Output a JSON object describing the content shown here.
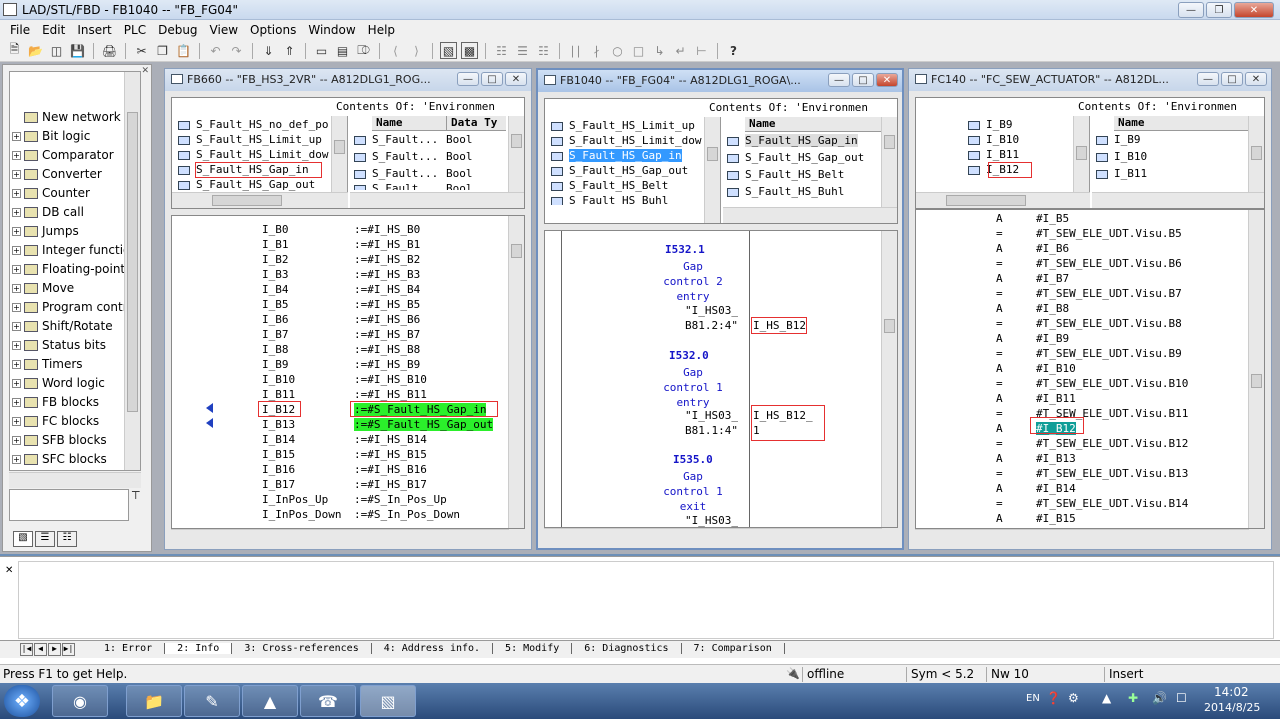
{
  "app": {
    "title": "LAD/STL/FBD  - FB1040 -- \"FB_FG04\""
  },
  "menu": [
    "File",
    "Edit",
    "Insert",
    "PLC",
    "Debug",
    "View",
    "Options",
    "Window",
    "Help"
  ],
  "catalog": {
    "items": [
      "New network",
      "Bit logic",
      "Comparator",
      "Converter",
      "Counter",
      "DB call",
      "Jumps",
      "Integer functio",
      "Floating-point",
      "Move",
      "Program contr",
      "Shift/Rotate",
      "Status bits",
      "Timers",
      "Word logic",
      "FB blocks",
      "FC blocks",
      "SFB blocks",
      "SFC blocks"
    ]
  },
  "win1": {
    "title": "FB660 -- \"FB_HS3_2VR\" -- A812DLG1_ROG...",
    "contents_label": "Contents Of: 'Environmen",
    "left_list": [
      "S_Fault_HS_no_def_po",
      "S_Fault_HS_Limit_up",
      "S_Fault_HS_Limit_dow",
      "S_Fault_HS_Gap_in",
      "S_Fault_HS_Gap_out"
    ],
    "col_name": "Name",
    "col_type": "Data Ty",
    "right_rows": [
      [
        "S_Fault...",
        "Bool"
      ],
      [
        "S_Fault...",
        "Bool"
      ],
      [
        "S_Fault...",
        "Bool"
      ],
      [
        "S_Fault...",
        "Bool"
      ]
    ],
    "code": [
      [
        "I_B0",
        ":=#I_HS_B0"
      ],
      [
        "I_B1",
        ":=#I_HS_B1"
      ],
      [
        "I_B2",
        ":=#I_HS_B2"
      ],
      [
        "I_B3",
        ":=#I_HS_B3"
      ],
      [
        "I_B4",
        ":=#I_HS_B4"
      ],
      [
        "I_B5",
        ":=#I_HS_B5"
      ],
      [
        "I_B6",
        ":=#I_HS_B6"
      ],
      [
        "I_B7",
        ":=#I_HS_B7"
      ],
      [
        "I_B8",
        ":=#I_HS_B8"
      ],
      [
        "I_B9",
        ":=#I_HS_B9"
      ],
      [
        "I_B10",
        ":=#I_HS_B10"
      ],
      [
        "I_B11",
        ":=#I_HS_B11"
      ],
      [
        "I_B12",
        ":=#S_Fault_HS_Gap_in"
      ],
      [
        "I_B13",
        ":=#S_Fault_HS_Gap_out"
      ],
      [
        "I_B14",
        ":=#I_HS_B14"
      ],
      [
        "I_B15",
        ":=#I_HS_B15"
      ],
      [
        "I_B16",
        ":=#I_HS_B16"
      ],
      [
        "I_B17",
        ":=#I_HS_B17"
      ],
      [
        "I_InPos_Up",
        ":=#S_In_Pos_Up"
      ],
      [
        "I_InPos_Down",
        ":=#S_In_Pos_Down"
      ]
    ]
  },
  "win2": {
    "title": "FB1040 -- \"FB_FG04\" -- A812DLG1_ROGA\\...",
    "contents_label": "Contents Of: 'Environmen",
    "left_list": [
      "S_Fault_HS_Limit_up",
      "S_Fault_HS_Limit_dow",
      "S_Fault_HS_Gap_in",
      "S_Fault_HS_Gap_out",
      "S_Fault_HS_Belt",
      "S_Fault_HS_Buhl"
    ],
    "col_name": "Name",
    "right_list": [
      "S_Fault_HS_Gap_in",
      "S_Fault_HS_Gap_out",
      "S_Fault_HS_Belt",
      "S_Fault_HS_Buhl"
    ],
    "blocks": [
      {
        "addr": "I532.1",
        "lines": [
          "Gap",
          "control 2",
          "entry"
        ],
        "sym1": "\"I_HS03_",
        "sym2": "B81.2:4\"",
        "out": "I_HS_B12",
        "out2": ""
      },
      {
        "addr": "I532.0",
        "lines": [
          "Gap",
          "control 1",
          "entry"
        ],
        "sym1": "\"I_HS03_",
        "sym2": "B81.1:4\"",
        "out": "I_HS_B12_",
        "out2": "1"
      },
      {
        "addr": "I535.0",
        "lines": [
          "Gap",
          "control 1",
          "exit"
        ],
        "sym1": "\"I_HS03_",
        "sym2": "",
        "out": "",
        "out2": ""
      }
    ]
  },
  "win3": {
    "title": "FC140 -- \"FC_SEW_ACTUATOR\" -- A812DL...",
    "contents_label": "Contents Of: 'Environmen",
    "left_list": [
      "I_B9",
      "I_B10",
      "I_B11",
      "I_B12"
    ],
    "col_name": "Name",
    "right_list": [
      "I_B9",
      "I_B10",
      "I_B11"
    ],
    "code": [
      [
        "A",
        "#I_B5"
      ],
      [
        "=",
        "#T_SEW_ELE_UDT.Visu.B5"
      ],
      [
        "A",
        "#I_B6"
      ],
      [
        "=",
        "#T_SEW_ELE_UDT.Visu.B6"
      ],
      [
        "A",
        "#I_B7"
      ],
      [
        "=",
        "#T_SEW_ELE_UDT.Visu.B7"
      ],
      [
        "A",
        "#I_B8"
      ],
      [
        "=",
        "#T_SEW_ELE_UDT.Visu.B8"
      ],
      [
        "A",
        "#I_B9"
      ],
      [
        "=",
        "#T_SEW_ELE_UDT.Visu.B9"
      ],
      [
        "A",
        "#I_B10"
      ],
      [
        "=",
        "#T_SEW_ELE_UDT.Visu.B10"
      ],
      [
        "A",
        "#I_B11"
      ],
      [
        "=",
        "#T_SEW_ELE_UDT.Visu.B11"
      ],
      [
        "A",
        "#I_B12"
      ],
      [
        "=",
        "#T_SEW_ELE_UDT.Visu.B12"
      ],
      [
        "A",
        "#I_B13"
      ],
      [
        "=",
        "#T_SEW_ELE_UDT.Visu.B13"
      ],
      [
        "A",
        "#I_B14"
      ],
      [
        "=",
        "#T_SEW_ELE_UDT.Visu.B14"
      ],
      [
        "A",
        "#I_B15"
      ]
    ]
  },
  "output_tabs": [
    "1: Error",
    "2: Info",
    "3: Cross-references",
    "4: Address info.",
    "5: Modify",
    "6: Diagnostics",
    "7: Comparison"
  ],
  "status": {
    "help": "Press F1 to get Help.",
    "mode": "offline",
    "sym": "Sym < 5.2",
    "nw": "Nw 10",
    "ins": "Insert"
  },
  "taskbar": {
    "lang": "EN",
    "time": "14:02",
    "date": "2014/8/25"
  }
}
